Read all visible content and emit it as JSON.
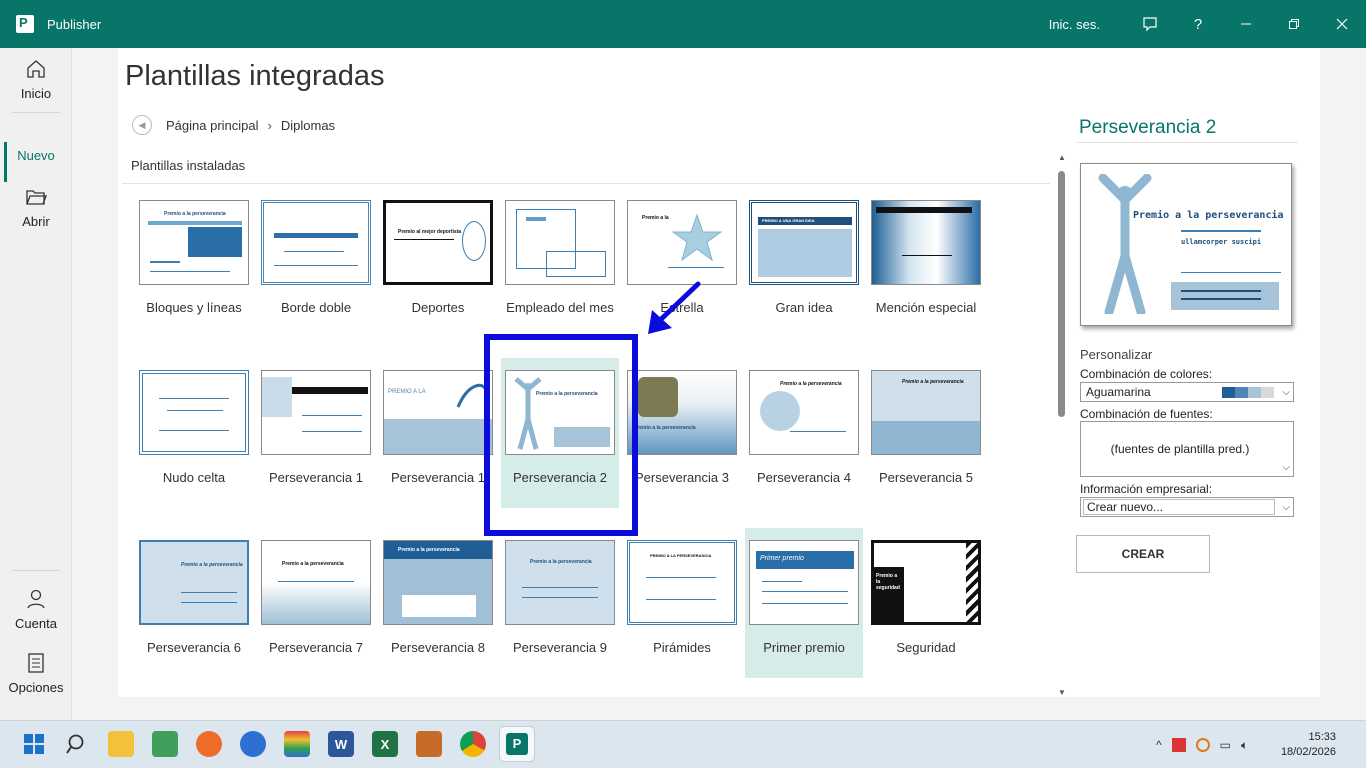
{
  "window": {
    "app_name": "Publisher",
    "sign_in": "Inic. ses.",
    "help": "?"
  },
  "nav": {
    "home": "Inicio",
    "new": "Nuevo",
    "open": "Abrir",
    "account": "Cuenta",
    "options": "Opciones"
  },
  "main": {
    "title": "Plantillas integradas",
    "breadcrumb": [
      "Página principal",
      "Diplomas"
    ],
    "section": "Plantillas instaladas",
    "templates": [
      "Bloques y líneas",
      "Borde doble",
      "Deportes",
      "Empleado del mes",
      "Estrella",
      "Gran idea",
      "Mención especial",
      "Nudo celta",
      "Perseverancia  1",
      "Perseverancia  1",
      "Perseverancia  2",
      "Perseverancia  3",
      "Perseverancia  4",
      "Perseverancia  5",
      "Perseverancia  6",
      "Perseverancia  7",
      "Perseverancia  8",
      "Perseverancia  9",
      "Pirámides",
      "Primer premio",
      "Seguridad"
    ],
    "selected_index": 10,
    "thumb_text": {
      "premio": "Premio a la perseverancia",
      "deportes": "Premio al mejor deportista",
      "gran_idea": "PREMIO A UNA GRAN IDEA",
      "primer": "Primer premio",
      "seguridad": "Premio a la seguridad"
    }
  },
  "panel": {
    "title": "Perseverancia  2",
    "preview_title": "Premio a la perseverancia",
    "preview_sub": "ullamcorper suscipi",
    "personalize": "Personalizar",
    "colors_label": "Combinación de colores:",
    "colors_value": "Aguamarina",
    "fonts_label": "Combinación de fuentes:",
    "fonts_value": "(fuentes de plantilla pred.)",
    "business_label": "Información empresarial:",
    "business_value": "Crear nuevo...",
    "create": "CREAR",
    "swatch_colors": [
      "#1f5f95",
      "#4f86b3",
      "#a7c3d8",
      "#d9d9d9"
    ]
  },
  "taskbar": {
    "time": "15:33",
    "date": "18/02/2026"
  },
  "colors": {
    "accent": "#077568",
    "annotation": "#0b0bdc"
  }
}
